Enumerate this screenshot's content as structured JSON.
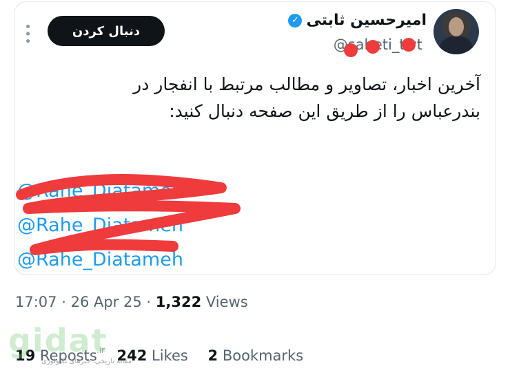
{
  "tweet": {
    "author_name": "امیرحسین ثابتی",
    "handle": "@sabeti_twt",
    "follow_label": "دنبال کردن",
    "text_line1": "آخرین اخبار، تصاویر و مطالب مرتبط با انفجار در",
    "text_line2": "بندرعباس را از طریق این صفحه دنبال کنید:",
    "mentions": [
      "@Rahe_Diatameh",
      "@Rahe_Diatamen",
      "@Rahe_Diatameh"
    ]
  },
  "meta": {
    "time": "17:07",
    "date": "26 Apr 25",
    "views_count": "1,322",
    "views_label": "Views",
    "separator": "·"
  },
  "stats": {
    "reposts_count": "19",
    "reposts_label": "Reposts",
    "likes_count": "242",
    "likes_label": "Likes",
    "bookmarks_count": "2",
    "bookmarks_label": "Bookmarks"
  },
  "watermark": {
    "logo": "gidat",
    "tld": ".ir",
    "tagline": "مقاله تاریخی، خبرهای تکنولوژی"
  },
  "colors": {
    "accent": "#1d9bf0",
    "redaction": "#ef3b3b",
    "text": "#0f1419",
    "muted": "#536471"
  }
}
